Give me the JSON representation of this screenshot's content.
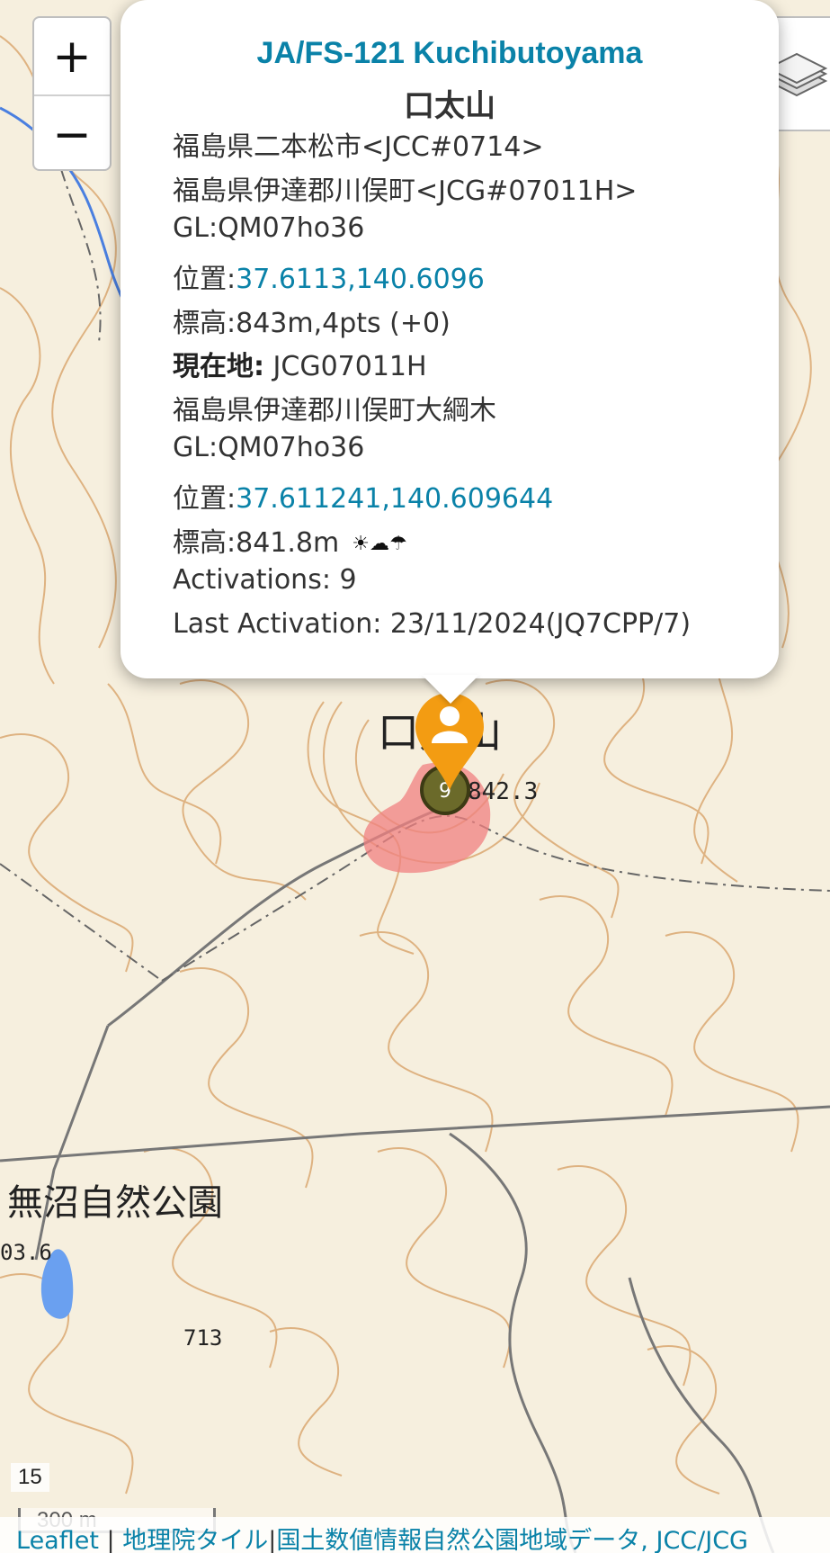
{
  "zoom_controls": {
    "zoom_in": "+",
    "zoom_out": "−"
  },
  "layers_icon": "layers-icon",
  "popup": {
    "title": "JA/FS-121 Kuchibutoyama",
    "name": "口太山",
    "jcc": "福島県二本松市<JCC#0714>",
    "jcg": "福島県伊達郡川俣町<JCG#07011H>",
    "gl1": "GL:QM07ho36",
    "pos1_label": "位置:",
    "pos1_value": "37.6113,140.6096",
    "elev1": "標高:843m,4pts (+0)",
    "current_label": "現在地:",
    "current_value": " JCG07011H",
    "address": "福島県伊達郡川俣町大綱木",
    "gl2": "GL:QM07ho36",
    "pos2_label": "位置:",
    "pos2_value": "37.611241,140.609644",
    "elev2": "標高:841.8m",
    "weather_icons": "☀☁☂",
    "activations": "Activations: 9",
    "last_activation": "Last Activation: 23/11/2024(JQ7CPP/7)",
    "close": "×"
  },
  "marker": {
    "count": "9",
    "icon": "person-icon",
    "color": "#f39c12"
  },
  "map_labels": {
    "peak_name": "口太山",
    "peak_elev": "842.3",
    "park_name": "無沼自然公園",
    "elev_713": "713",
    "elev_left": "03.6"
  },
  "zoom_level": "15",
  "scale_label": "300 m",
  "attribution": {
    "leaflet": "Leaflet",
    "sep1": " | ",
    "tiles": "地理院タイル",
    "sep2": "|",
    "rest": "国土数値情報自然公園地域データ, JCC/JCG"
  },
  "colors": {
    "link": "#0a82a8",
    "contour": "#d9a46a",
    "area": "#f08080",
    "water": "#6aa0f0"
  }
}
